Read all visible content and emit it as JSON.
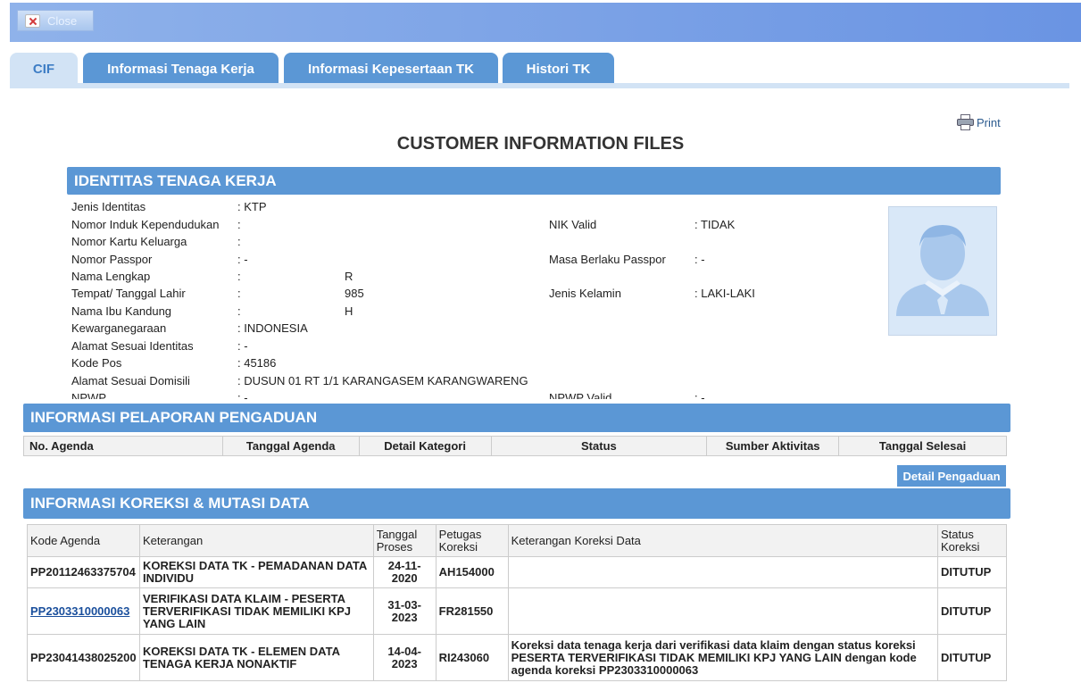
{
  "toolbar": {
    "close_label": "Close"
  },
  "tabs": [
    {
      "label": "CIF"
    },
    {
      "label": "Informasi Tenaga Kerja"
    },
    {
      "label": "Informasi Kepesertaan TK"
    },
    {
      "label": "Histori TK"
    }
  ],
  "print_label": "Print",
  "page_title": "CUSTOMER INFORMATION FILES",
  "identitas": {
    "title": "IDENTITAS TENAGA KERJA",
    "left": [
      {
        "label": "Jenis Identitas",
        "value": ": KTP"
      },
      {
        "label": "Nomor Induk Kependudukan",
        "value": ":"
      },
      {
        "label": "Nomor Kartu Keluarga",
        "value": ":"
      },
      {
        "label": "Nomor Passpor",
        "value": ": -"
      },
      {
        "label": "Nama Lengkap",
        "value": ":",
        "extra": "R"
      },
      {
        "label": "Tempat/ Tanggal Lahir",
        "value": ":",
        "extra": "985"
      },
      {
        "label": "Nama Ibu Kandung",
        "value": ":",
        "extra": "H"
      },
      {
        "label": "Kewarganegaraan",
        "value": ": INDONESIA"
      },
      {
        "label": "Alamat Sesuai Identitas",
        "value": ": -"
      },
      {
        "label": "Kode Pos",
        "value": ": 45186"
      },
      {
        "label": "Alamat Sesuai Domisili",
        "value": ": DUSUN 01 RT 1/1 KARANGASEM KARANGWARENG"
      },
      {
        "label": "NPWP",
        "value": ": -"
      }
    ],
    "right": [
      {
        "label": "NIK Valid",
        "value": ": TIDAK"
      },
      {
        "label": "Masa Berlaku Passpor",
        "value": ": -"
      },
      {
        "label": "Jenis Kelamin",
        "value": ": LAKI-LAKI"
      },
      {
        "label": "NPWP Valid",
        "value": ": -"
      }
    ]
  },
  "pengaduan": {
    "title": "INFORMASI PELAPORAN PENGADUAN",
    "columns": [
      "No. Agenda",
      "Tanggal Agenda",
      "Detail Kategori",
      "Status",
      "Sumber Aktivitas",
      "Tanggal Selesai"
    ],
    "detail_button": "Detail Pengaduan"
  },
  "koreksi": {
    "title": "INFORMASI KOREKSI & MUTASI DATA",
    "columns": [
      "Kode Agenda",
      "Keterangan",
      "Tanggal Proses",
      "Petugas Koreksi",
      "Keterangan Koreksi Data",
      "Status Koreksi"
    ],
    "rows": [
      {
        "kode": "PP20112463375704",
        "keterangan": "KOREKSI DATA TK - PEMADANAN DATA INDIVIDU",
        "tanggal": "24-11-2020",
        "petugas": "AH154000",
        "ket_koreksi": "",
        "status": "DITUTUP"
      },
      {
        "kode": "PP2303310000063",
        "keterangan": "VERIFIKASI DATA KLAIM - PESERTA TERVERIFIKASI TIDAK MEMILIKI KPJ YANG LAIN",
        "tanggal": "31-03-2023",
        "petugas": "FR281550",
        "ket_koreksi": "",
        "status": "DITUTUP"
      },
      {
        "kode": "PP23041438025200",
        "keterangan": "KOREKSI DATA TK - ELEMEN DATA TENAGA KERJA NONAKTIF",
        "tanggal": "14-04-2023",
        "petugas": "RI243060",
        "ket_koreksi": "Koreksi data tenaga kerja dari verifikasi data klaim dengan status koreksi PESERTA TERVERIFIKASI TIDAK MEMILIKI KPJ YANG LAIN dengan kode agenda koreksi PP2303310000063",
        "status": "DITUTUP"
      }
    ]
  }
}
